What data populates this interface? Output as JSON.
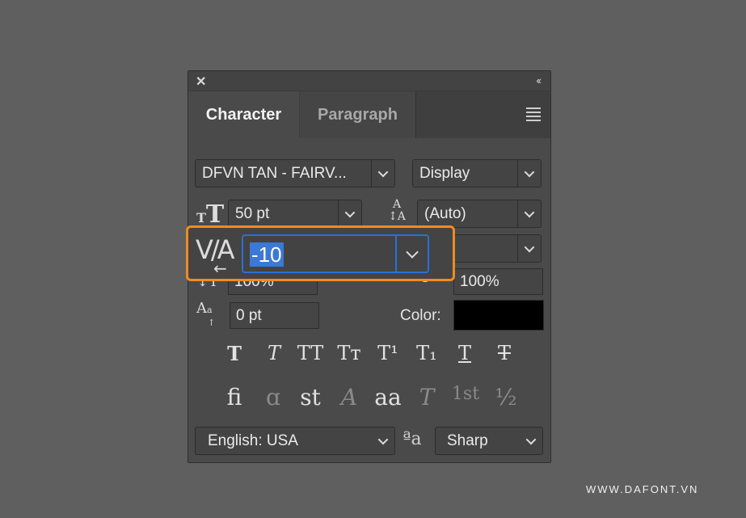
{
  "panel": {
    "close_icon": "close-icon",
    "collapse_label": "‹‹",
    "tabs": [
      {
        "label": "Character"
      },
      {
        "label": "Paragraph"
      }
    ],
    "menu_icon": "hamburger-menu-icon"
  },
  "font": {
    "family": "DFVN TAN - FAIRV...",
    "style": "Display"
  },
  "size": {
    "value": "50 pt"
  },
  "leading": {
    "value": "(Auto)"
  },
  "tracking": {
    "value": "-10"
  },
  "scale": {
    "vertical": "100%",
    "horizontal": "100%"
  },
  "baseline": {
    "value": "0 pt"
  },
  "color": {
    "label": "Color:",
    "swatch": "#000000"
  },
  "type_styles": [
    {
      "glyph": "T",
      "name": "faux-bold-icon"
    },
    {
      "glyph": "T",
      "name": "faux-italic-icon"
    },
    {
      "glyph": "TT",
      "name": "all-caps-icon"
    },
    {
      "glyph": "Tт",
      "name": "small-caps-icon"
    },
    {
      "glyph": "T¹",
      "name": "superscript-icon"
    },
    {
      "glyph": "T₁",
      "name": "subscript-icon"
    },
    {
      "glyph": "T",
      "name": "underline-icon"
    },
    {
      "glyph": "T",
      "name": "strikethrough-icon"
    }
  ],
  "opentype": [
    {
      "glyph": "fi",
      "name": "ligatures-icon"
    },
    {
      "glyph": "ɑ",
      "name": "contextual-alternates-icon"
    },
    {
      "glyph": "st",
      "name": "discretionary-ligatures-icon"
    },
    {
      "glyph": "A",
      "name": "swash-icon"
    },
    {
      "glyph": "aa",
      "name": "stylistic-alternates-icon"
    },
    {
      "glyph": "T",
      "name": "titling-alternates-icon"
    },
    {
      "glyph": "1st",
      "name": "ordinals-icon"
    },
    {
      "glyph": "½",
      "name": "fractions-icon"
    }
  ],
  "language": {
    "value": "English: USA"
  },
  "antialias": {
    "icon": "anti-aliasing-icon",
    "glyph": "ªa",
    "value": "Sharp"
  },
  "watermark": "WWW.DAFONT.VN"
}
